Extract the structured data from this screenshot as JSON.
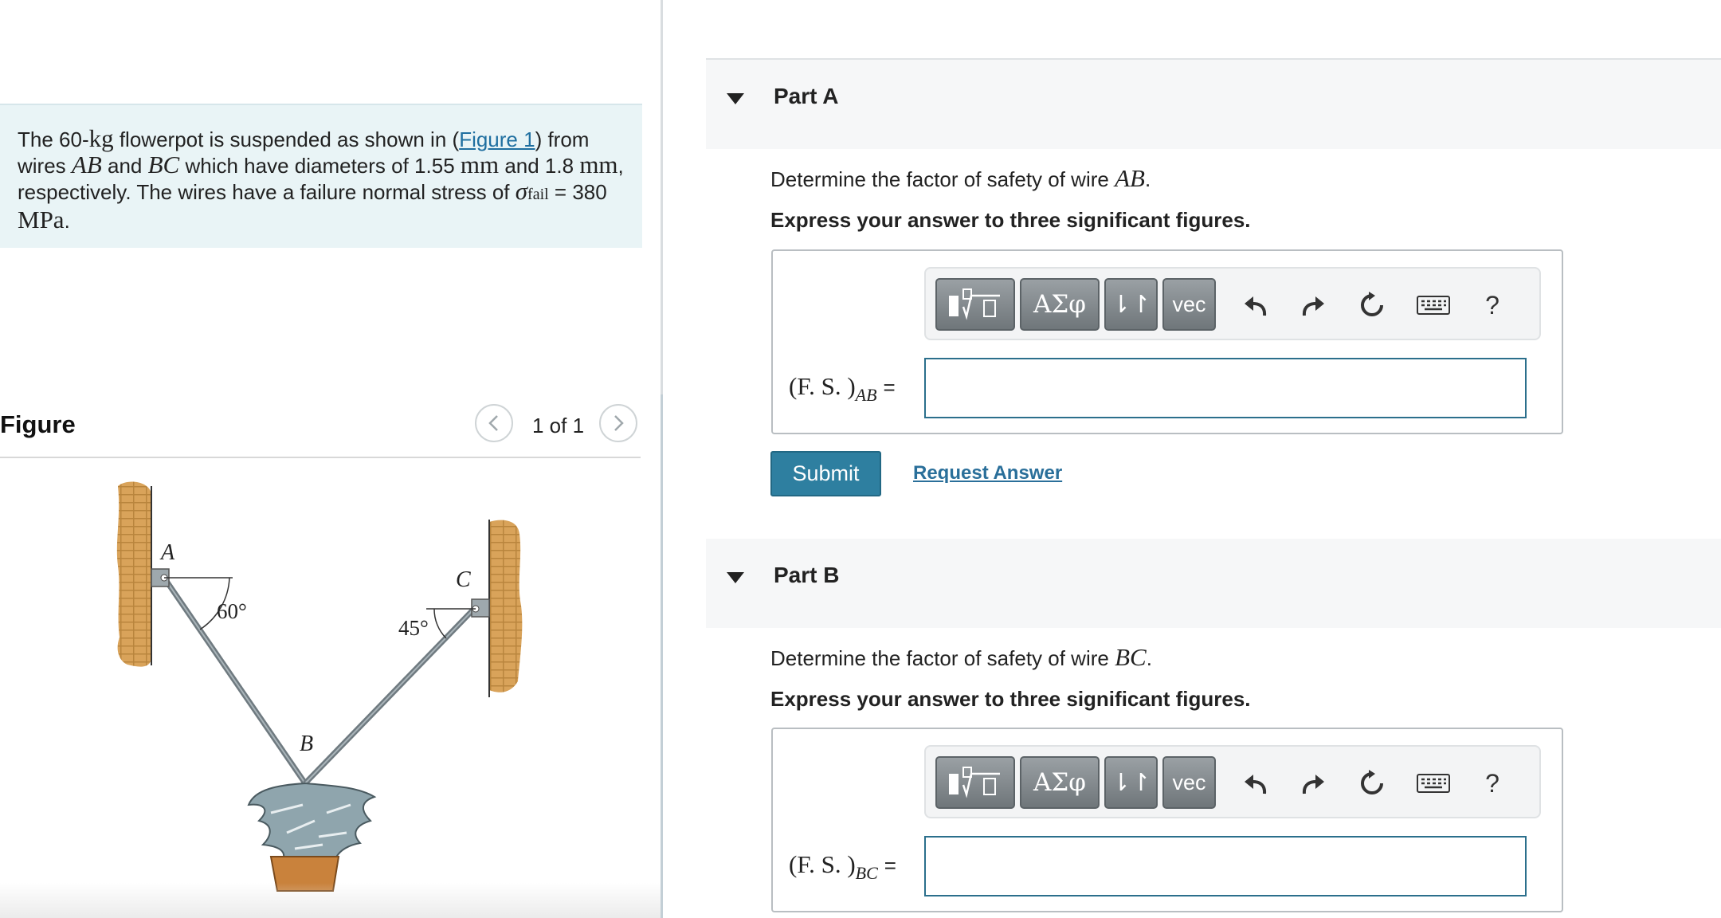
{
  "problem": {
    "text_1": "The 60-",
    "mass_unit": "kg",
    "text_2": " flowerpot is suspended as shown in (",
    "figure_link": "Figure 1",
    "text_3": ") from wires ",
    "wire_ab": "AB",
    "text_4": " and ",
    "wire_bc": "BC",
    "text_5": " which have diameters of 1.55 ",
    "mm_1": "mm",
    "text_6": " and 1.8 ",
    "mm_2": "mm",
    "text_7": ", respectively. The wires have a failure normal stress of ",
    "sigma": "σ",
    "sigma_sub": "fail",
    "text_8": " = 380 ",
    "stress_unit": "MPa",
    "text_9": "."
  },
  "figure": {
    "title": "Figure",
    "page_counter": "1 of 1",
    "label_a": "A",
    "label_b": "B",
    "label_c": "C",
    "angle_a": "60°",
    "angle_c": "45°"
  },
  "parts": [
    {
      "title": "Part A",
      "question_prefix": "Determine the factor of safety of wire ",
      "question_var": "AB",
      "question_suffix": ".",
      "instruction": "Express your answer to three significant figures.",
      "lhs_main": "(F. S. )",
      "lhs_sub": "AB",
      "lhs_eq": "=",
      "input_value": ""
    },
    {
      "title": "Part B",
      "question_prefix": "Determine the factor of safety of wire ",
      "question_var": "BC",
      "question_suffix": ".",
      "instruction": "Express your answer to three significant figures.",
      "lhs_main": "(F. S. )",
      "lhs_sub": "BC",
      "lhs_eq": "=",
      "input_value": ""
    }
  ],
  "toolbar": {
    "greek_label": "ΑΣφ",
    "arrows_label": "⇂↾",
    "vec_label": "vec",
    "help_label": "?",
    "icons": [
      "templates-icon",
      "undo-icon",
      "redo-icon",
      "reset-icon",
      "keyboard-icon",
      "help-icon"
    ]
  },
  "actions": {
    "submit_label": "Submit",
    "request_answer_label": "Request Answer"
  },
  "colors": {
    "problem_bg": "#e9f4f6",
    "link": "#1f6fa0",
    "submit_bg": "#2e7fa0",
    "input_border": "#2b6f8c"
  }
}
